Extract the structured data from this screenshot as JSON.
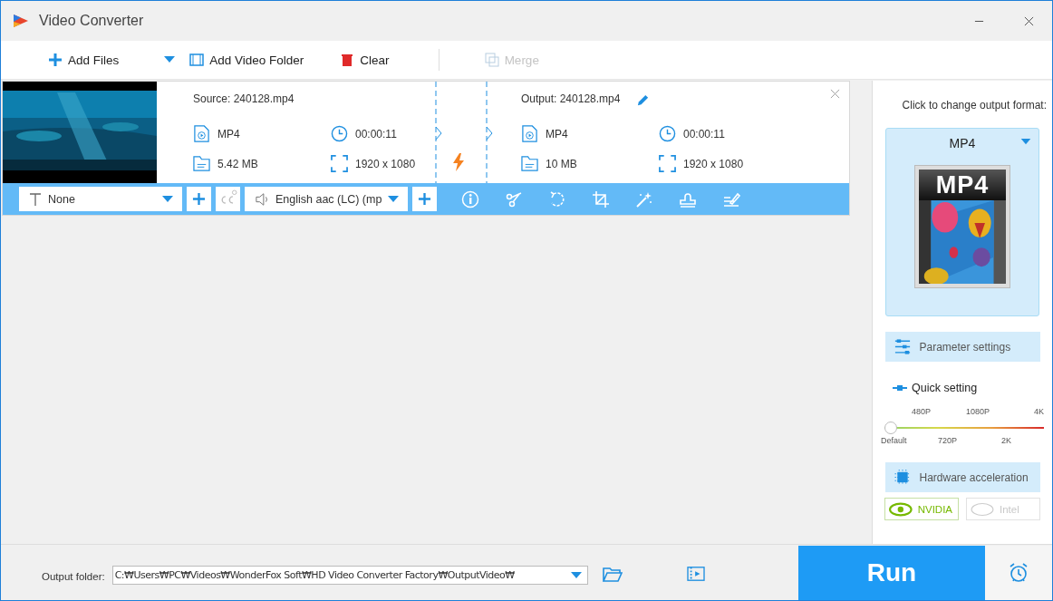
{
  "window": {
    "title": "Video Converter"
  },
  "toolbar": [
    {
      "kind": "add",
      "label": "Add Files",
      "disabled": false
    },
    {
      "kind": "dropdown",
      "disabled": false
    },
    {
      "kind": "folder",
      "label": "Add Video Folder",
      "disabled": false
    },
    {
      "kind": "clear",
      "label": "Clear",
      "disabled": false
    },
    {
      "kind": "merge",
      "label": "Merge",
      "disabled": true
    }
  ],
  "file": {
    "source": {
      "name": "Source: 240128.mp4",
      "format": "MP4",
      "duration": "00:00:11",
      "size": "5.42 MB",
      "resolution": "1920 x 1080"
    },
    "output": {
      "name": "Output: 240128.mp4",
      "format": "MP4",
      "duration": "00:00:11",
      "size": "10 MB",
      "resolution": "1920 x 1080"
    },
    "subtitle": "None",
    "audio": "English aac (LC) (mp"
  },
  "format_panel": {
    "hint": "Click to change output format:",
    "format": "MP4",
    "format_badge": "MP4",
    "parameter_settings": "Parameter settings",
    "quick_setting": "Quick setting",
    "quality_slider": {
      "level": 0,
      "top_labels": [
        "480P",
        "1080P",
        "4K"
      ],
      "bottom_labels": [
        "Default",
        "720P",
        "2K"
      ]
    },
    "hardware_acceleration": "Hardware acceleration",
    "encoders": [
      {
        "label": "NVIDIA",
        "selected": true
      },
      {
        "label": "Intel",
        "selected": false
      }
    ]
  },
  "bottom": {
    "output_folder_label": "Output folder:",
    "output_folder": "C:₩Users₩PC₩Videos₩WonderFox Soft₩HD Video Converter Factory₩OutputVideo₩",
    "run": "Run"
  }
}
